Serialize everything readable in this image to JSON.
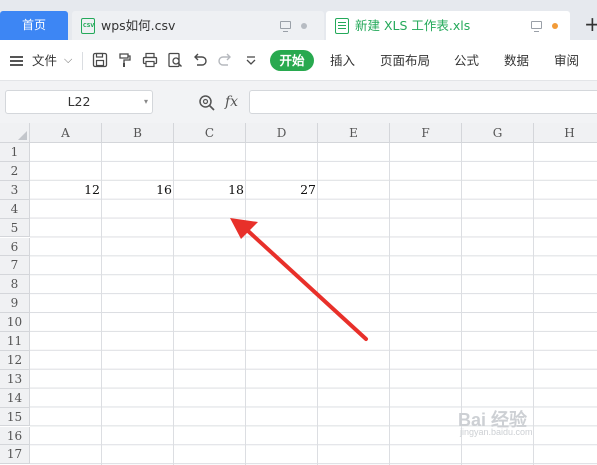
{
  "tabs": {
    "home_label": "首页",
    "files": [
      {
        "label": "wps如何.csv",
        "icon": "csv-file-icon"
      },
      {
        "label": "新建 XLS 工作表.xls",
        "icon": "xls-file-icon"
      }
    ],
    "new_tab": "+"
  },
  "ribbon": {
    "menu_label": "文件",
    "start_label": "开始",
    "tabs": [
      "插入",
      "页面布局",
      "公式",
      "数据",
      "审阅"
    ],
    "icons": [
      "save-icon",
      "format-painter-icon",
      "print-icon",
      "print-preview-icon",
      "undo-icon",
      "redo-icon",
      "more-dropdown-icon"
    ]
  },
  "formula_bar": {
    "name_box": "L22",
    "fx_label": "fx",
    "formula": ""
  },
  "sheet": {
    "columns": [
      "A",
      "B",
      "C",
      "D",
      "E",
      "F",
      "G",
      "H"
    ],
    "rows": [
      "1",
      "2",
      "3",
      "4",
      "5",
      "6",
      "7",
      "8",
      "9",
      "10",
      "11",
      "12",
      "13",
      "14",
      "15",
      "16",
      "17"
    ],
    "cells": [
      {
        "ref": "A3",
        "value": "12"
      },
      {
        "ref": "B3",
        "value": "16"
      },
      {
        "ref": "C3",
        "value": "18"
      },
      {
        "ref": "D3",
        "value": "27"
      }
    ]
  },
  "annotation": {
    "color": "#e8302a"
  },
  "watermark": {
    "text": "Bai 经验",
    "sub": "jingyan.baidu.com"
  },
  "colors": {
    "accent_blue": "#3d86f4",
    "accent_green": "#28a94f",
    "tab_bar": "#e6e9ee"
  }
}
